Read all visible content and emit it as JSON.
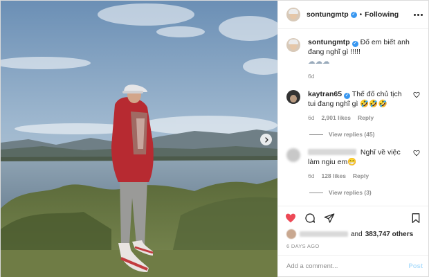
{
  "post": {
    "author": "sontungmtp",
    "following_label": "Following",
    "separator": "•"
  },
  "caption": {
    "username": "sontungmtp",
    "text": "Đố em biết anh đang nghĩ gì !!!!!",
    "emoji": "☁☁☁",
    "time": "6d"
  },
  "comments": [
    {
      "username": "kaytran65",
      "text": "Thế đố chủ tịch tui đang nghĩ gì 🤣🤣🤣",
      "time": "6d",
      "likes": "2,901 likes",
      "reply_label": "Reply",
      "view_replies": "View replies (45)"
    },
    {
      "username": "",
      "text": "Nghĩ về việc làm ngiu em😁",
      "time": "6d",
      "likes": "128 likes",
      "reply_label": "Reply",
      "view_replies": "View replies (3)"
    }
  ],
  "likes": {
    "and_label": "and",
    "count_text": "383,747 others"
  },
  "time_ago": "6 DAYS AGO",
  "add_comment": {
    "placeholder": "Add a comment...",
    "post_label": "Post"
  },
  "colors": {
    "like_red": "#ed4956",
    "verified_blue": "#3897f0",
    "post_disabled": "#b2dffc"
  },
  "icons": [
    "verified-badge-icon",
    "more-options-icon",
    "heart-icon",
    "comment-icon",
    "share-icon",
    "bookmark-icon",
    "next-arrow-icon"
  ]
}
